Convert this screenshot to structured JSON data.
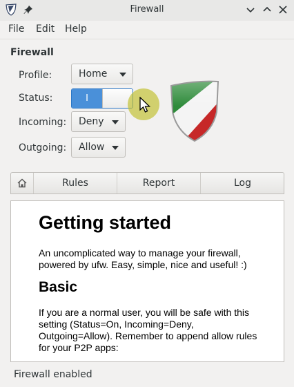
{
  "window": {
    "title": "Firewall"
  },
  "menu": {
    "items": [
      "File",
      "Edit",
      "Help"
    ]
  },
  "section_heading": "Firewall",
  "settings": {
    "profile_label": "Profile:",
    "profile_value": "Home",
    "status_label": "Status:",
    "status_switch_text": "I",
    "status_on": true,
    "incoming_label": "Incoming:",
    "incoming_value": "Deny",
    "outgoing_label": "Outgoing:",
    "outgoing_value": "Allow"
  },
  "tabs": [
    "Rules",
    "Report",
    "Log"
  ],
  "doc": {
    "title": "Getting started",
    "intro": "An uncomplicated way to manage your firewall, powered by ufw. Easy, simple, nice and useful! :)",
    "basic_heading": "Basic",
    "basic_text": "If you are a normal user, you will be safe with this setting (Status=On, Incoming=Deny, Outgoing=Allow). Remember to append allow rules for your P2P apps:"
  },
  "statusbar": {
    "text": "Firewall enabled"
  },
  "colors": {
    "accent": "#4a90d9",
    "logo_green": "#2e8b3a",
    "logo_red": "#c62828"
  }
}
